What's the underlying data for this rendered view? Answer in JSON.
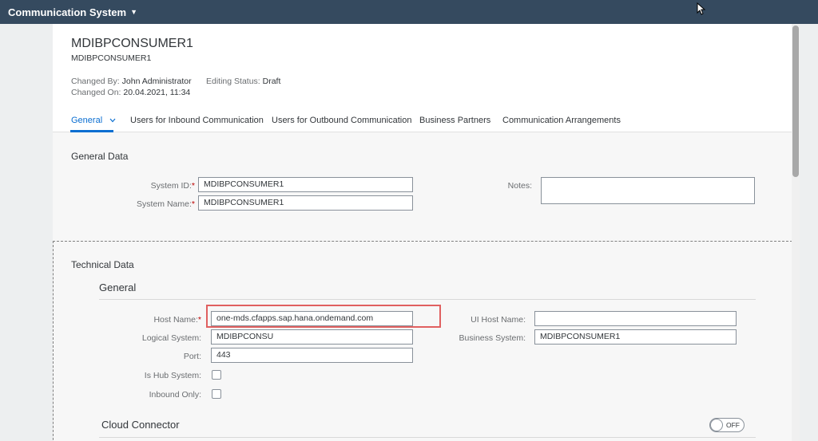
{
  "shell": {
    "app_title": "Communication System"
  },
  "header": {
    "title": "MDIBPCONSUMER1",
    "subtitle": "MDIBPCONSUMER1",
    "changed_by_label": "Changed By:",
    "changed_by_value": "John Administrator",
    "changed_on_label": "Changed On:",
    "changed_on_value": "20.04.2021, 11:34",
    "editing_status_label": "Editing Status:",
    "editing_status_value": "Draft"
  },
  "tabs": [
    {
      "label": "General"
    },
    {
      "label": "Users for Inbound Communication"
    },
    {
      "label": "Users for Outbound Communication"
    },
    {
      "label": "Business Partners"
    },
    {
      "label": "Communication Arrangements"
    }
  ],
  "general_data": {
    "title": "General Data",
    "system_id_label": "System ID:",
    "system_id_value": "MDIBPCONSUMER1",
    "system_name_label": "System Name:",
    "system_name_value": "MDIBPCONSUMER1",
    "notes_label": "Notes:",
    "notes_value": ""
  },
  "technical_data": {
    "title": "Technical Data",
    "general_subtitle": "General",
    "host_name_label": "Host Name:",
    "host_name_value": "one-mds.cfapps.sap.hana.ondemand.com",
    "logical_system_label": "Logical System:",
    "logical_system_value": "MDIBPCONSU",
    "port_label": "Port:",
    "port_value": "443",
    "is_hub_label": "Is Hub System:",
    "is_hub_checked": false,
    "inbound_only_label": "Inbound Only:",
    "inbound_only_checked": false,
    "ui_host_name_label": "UI Host Name:",
    "ui_host_name_value": "",
    "business_system_label": "Business System:",
    "business_system_value": "MDIBPCONSUMER1",
    "cloud_connector_title": "Cloud Connector",
    "cloud_connector_toggle": "OFF"
  },
  "colors": {
    "shell_bar": "#354a5f",
    "accent": "#0a6ed1",
    "required": "#bb0000",
    "highlight_box": "#e06060"
  }
}
